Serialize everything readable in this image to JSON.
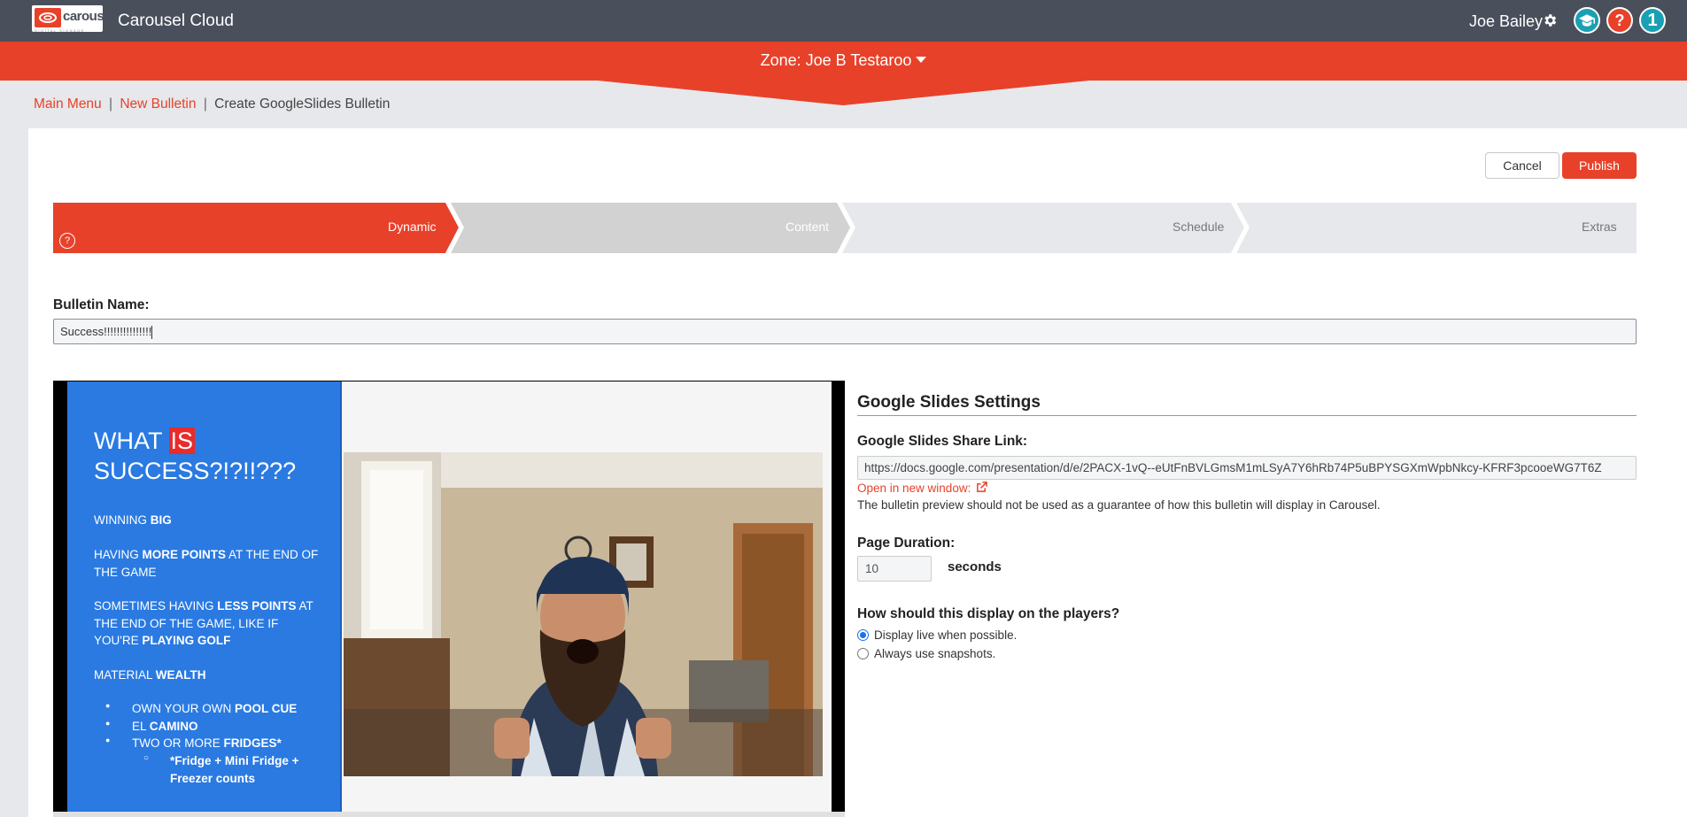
{
  "header": {
    "logo_word": "carousel",
    "logo_sub": "DIGITAL SIGNAGE",
    "app_title": "Carousel Cloud",
    "user_name": "Joe Bailey",
    "help_label": "?",
    "notification_count": "1"
  },
  "zone": {
    "label": "Zone: Joe B Testaroo"
  },
  "breadcrumb": {
    "main_menu": "Main Menu",
    "separator": "|",
    "new_bulletin": "New Bulletin",
    "current": "Create GoogleSlides Bulletin"
  },
  "actions": {
    "cancel": "Cancel",
    "publish": "Publish"
  },
  "steps": [
    {
      "label": "Dynamic",
      "state": "active"
    },
    {
      "label": "Content",
      "state": "next"
    },
    {
      "label": "Schedule",
      "state": "pending"
    },
    {
      "label": "Extras",
      "state": "pending"
    }
  ],
  "step_help": "?",
  "bulletin_name": {
    "label": "Bulletin Name:",
    "value": "Success!!!!!!!!!!!!!!!"
  },
  "slide": {
    "title_pre": "WHAT ",
    "title_highlight": "IS",
    "title_post": "SUCCESS?!?!!???",
    "line1_a": "WINNING ",
    "line1_b": "BIG",
    "line2_a": "HAVING ",
    "line2_b": "MORE POINTS",
    "line2_c": " AT THE END OF THE GAME",
    "line3_a": "SOMETIMES HAVING ",
    "line3_b": "LESS POINTS",
    "line3_c": " AT THE END OF THE GAME, LIKE IF YOU'RE ",
    "line3_d": "PLAYING GOLF",
    "line4_a": "MATERIAL ",
    "line4_b": "WEALTH",
    "bullet1_a": "OWN YOUR OWN ",
    "bullet1_b": "POOL CUE",
    "bullet2_a": "EL ",
    "bullet2_b": "CAMINO",
    "bullet3_a": "TWO OR MORE ",
    "bullet3_b": "FRIDGES*",
    "sub_bullet": "*Fridge + Mini Fridge + Freezer counts",
    "bullet_char": "●",
    "sub_bullet_char": "○"
  },
  "settings": {
    "title": "Google Slides Settings",
    "share_label": "Google Slides Share Link:",
    "share_value": "https://docs.google.com/presentation/d/e/2PACX-1vQ--eUtFnBVLGmsM1mLSyA7Y6hRb74P5uBPYSGXmWpbNkcy-KFRF3pcooeWG7T6Z",
    "open_link": "Open in new window:",
    "note": "The bulletin preview should not be used as a guarantee of how this bulletin will display in Carousel.",
    "duration_label": "Page Duration:",
    "duration_value": "10",
    "duration_unit": "seconds",
    "display_label": "How should this display on the players?",
    "option_live": "Display live when possible.",
    "option_snapshots": "Always use snapshots.",
    "selected_option": "live"
  },
  "colors": {
    "accent": "#e8412a",
    "topbar": "#4a4f5c",
    "slide_blue": "#2a7ae2",
    "step_content": "#d2d2d2",
    "step_pending": "#e6e8eb",
    "teal": "#19a0b4"
  }
}
